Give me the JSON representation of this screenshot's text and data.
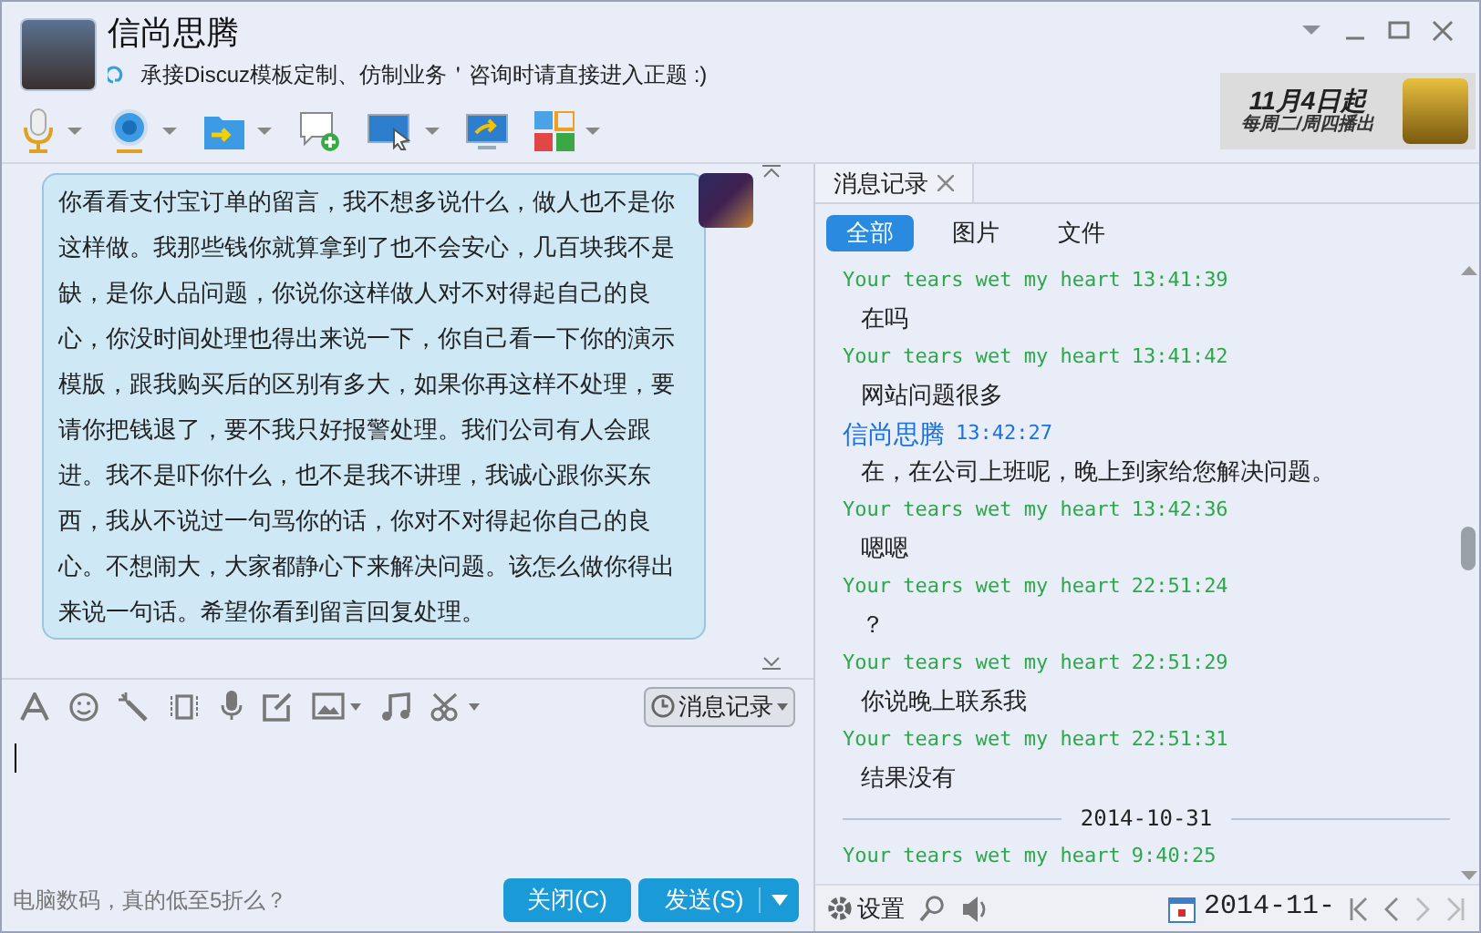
{
  "contact": {
    "name": "信尚思腾",
    "signature": "承接Discuz模板定制、仿制业务＇咨询时请直接进入正题 :)"
  },
  "ad_banner": {
    "line_1": "11月4日起",
    "line_2": "每周二/周四播出"
  },
  "chat": {
    "messages": [
      {
        "text": "你看看支付宝订单的留言，我不想多说什么，做人也不是你这样做。我那些钱你就算拿到了也不会安心，几百块我不是缺，是你人品问题，你说你这样做人对不对得起自己的良心，你没时间处理也得出来说一下，你自己看一下你的演示模版，跟我购买后的区别有多大，如果你再这样不处理，要请你把钱退了，要不我只好报警处理。我们公司有人会跟进。我不是吓你什么，也不是我不讲理，我诚心跟你买东西，我从不说过一句骂你的话，你对不对得起你自己的良心。不想闹大，大家都静心下来解决问题。该怎么做你得出来说一句话。希望你看到留言回复处理。"
      }
    ]
  },
  "composer": {
    "history_button": "消息记录",
    "tip": "电脑数码，真的低至5折么？",
    "buttons": [
      {
        "label": "关闭(C)",
        "kind": "plain"
      },
      {
        "label": "发送(S)",
        "kind": "split"
      }
    ]
  },
  "history": {
    "tab": "消息记录",
    "filters": [
      {
        "label": "全部",
        "selected": true
      },
      {
        "label": "图片",
        "selected": false
      },
      {
        "label": "文件",
        "selected": false
      }
    ],
    "entries": [
      {
        "kind": "message",
        "sender": "Your tears wet my heart",
        "time": "13:41:39",
        "from_me": false,
        "text": "在吗"
      },
      {
        "kind": "message",
        "sender": "Your tears wet my heart",
        "time": "13:41:42",
        "from_me": false,
        "text": "网站问题很多"
      },
      {
        "kind": "message",
        "sender": "信尚思腾",
        "time": "13:42:27",
        "from_me": true,
        "text": "在，在公司上班呢，晚上到家给您解决问题。"
      },
      {
        "kind": "message",
        "sender": "Your tears wet my heart",
        "time": "13:42:36",
        "from_me": false,
        "text": "嗯嗯"
      },
      {
        "kind": "message",
        "sender": "Your tears wet my heart",
        "time": "22:51:24",
        "from_me": false,
        "text": "？"
      },
      {
        "kind": "message",
        "sender": "Your tears wet my heart",
        "time": "22:51:29",
        "from_me": false,
        "text": "你说晚上联系我"
      },
      {
        "kind": "message",
        "sender": "Your tears wet my heart",
        "time": "22:51:31",
        "from_me": false,
        "text": "结果没有"
      },
      {
        "kind": "date",
        "text": "2014-10-31"
      },
      {
        "kind": "message",
        "sender": "Your tears wet my heart",
        "time": "9:40:25",
        "from_me": false
      }
    ],
    "settings": "设置",
    "date": "2014-11-"
  }
}
